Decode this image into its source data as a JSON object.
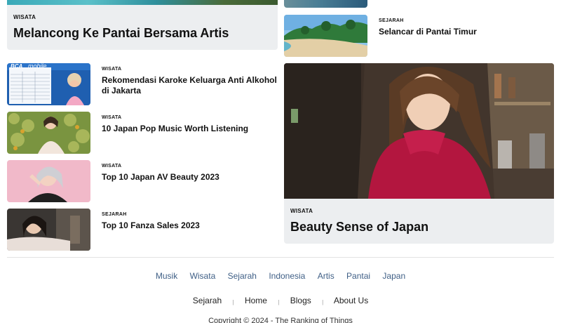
{
  "left_top_card": {
    "category": "WISATA",
    "title": "Melancong Ke Pantai Bersama Artis"
  },
  "left_list": [
    {
      "category": "WISATA",
      "title": "Rekomendasi Karoke Keluarga Anti Alkohol di Jakarta",
      "thumb_brand": "BCA",
      "thumb_tag": "mobile"
    },
    {
      "category": "WISATA",
      "title": "10 Japan Pop Music Worth Listening"
    },
    {
      "category": "WISATA",
      "title": "Top 10 Japan AV Beauty 2023"
    },
    {
      "category": "SEJARAH",
      "title": "Top 10 Fanza Sales 2023"
    }
  ],
  "right_item": {
    "category": "SEJARAH",
    "title": "Selancar di Pantai Timur"
  },
  "feature": {
    "category": "WISATA",
    "title": "Beauty Sense of Japan"
  },
  "footer": {
    "tags": [
      "Musik",
      "Wisata",
      "Sejarah",
      "Indonesia",
      "Artis",
      "Pantai",
      "Japan"
    ],
    "nav": [
      "Sejarah",
      "Home",
      "Blogs",
      "About Us"
    ],
    "copyright": "Copyright © 2024 - The Ranking of Things"
  },
  "colors": {
    "card_background": "#eceef0",
    "tag_link": "#3f5f86",
    "text": "#111111"
  }
}
